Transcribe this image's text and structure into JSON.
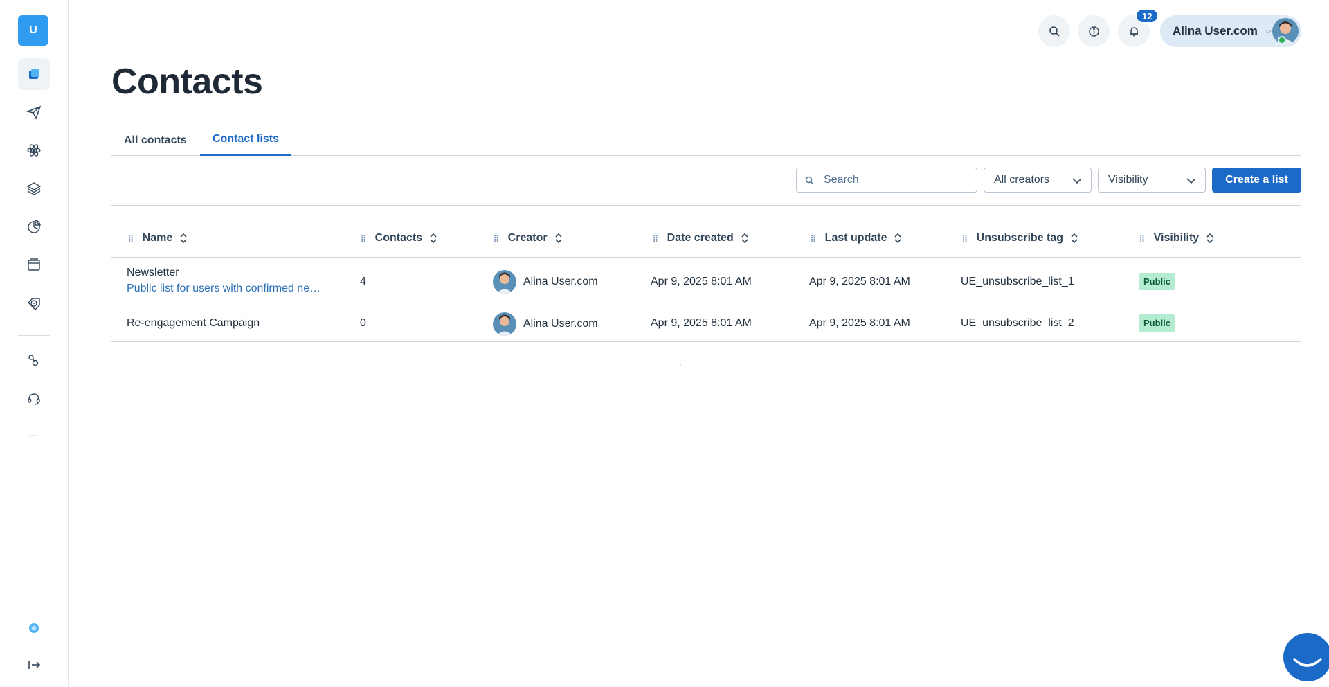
{
  "app": {
    "logo_letter": "U"
  },
  "topbar": {
    "notification_count": "12",
    "user_name": "Alina User.com",
    "caret": "⌄"
  },
  "page": {
    "title": "Contacts",
    "tabs": [
      {
        "label": "All contacts",
        "active": false
      },
      {
        "label": "Contact lists",
        "active": true
      }
    ]
  },
  "toolbar": {
    "search_placeholder": "Search",
    "creators_filter": "All creators",
    "visibility_filter": "Visibility",
    "create_button": "Create a list"
  },
  "table": {
    "columns": [
      "Name",
      "Contacts",
      "Creator",
      "Date created",
      "Last update",
      "Unsubscribe tag",
      "Visibility"
    ],
    "rows": [
      {
        "name": "Newsletter",
        "description": "Public list for users with confirmed newsletter subscription",
        "contacts": "4",
        "creator": "Alina User.com",
        "date_created": "Apr 9, 2025 8:01 AM",
        "last_update": "Apr 9, 2025 8:01 AM",
        "unsubscribe_tag": "UE_unsubscribe_list_1",
        "visibility": "Public"
      },
      {
        "name": "Re-engagement Campaign",
        "description": "",
        "contacts": "0",
        "creator": "Alina User.com",
        "date_created": "Apr 9, 2025 8:01 AM",
        "last_update": "Apr 9, 2025 8:01 AM",
        "unsubscribe_tag": "UE_unsubscribe_list_2",
        "visibility": "Public"
      }
    ]
  },
  "sidebar": {
    "more_label": "···"
  },
  "colors": {
    "primary": "#1c6ac8",
    "logo": "#2f9cf2",
    "badge_public_bg": "#b3ecd0",
    "badge_public_text": "#0f5c3a"
  },
  "icons": [
    "contacts-icon",
    "send-icon",
    "atom-icon",
    "layers-icon",
    "pie-chart-icon",
    "window-icon",
    "tag-icon",
    "integrations-icon",
    "headset-icon",
    "more-icon",
    "help-icon",
    "logout-icon",
    "search-icon",
    "info-icon",
    "bell-icon",
    "chevron-down-icon",
    "sort-icon",
    "drag-handle-icon"
  ]
}
